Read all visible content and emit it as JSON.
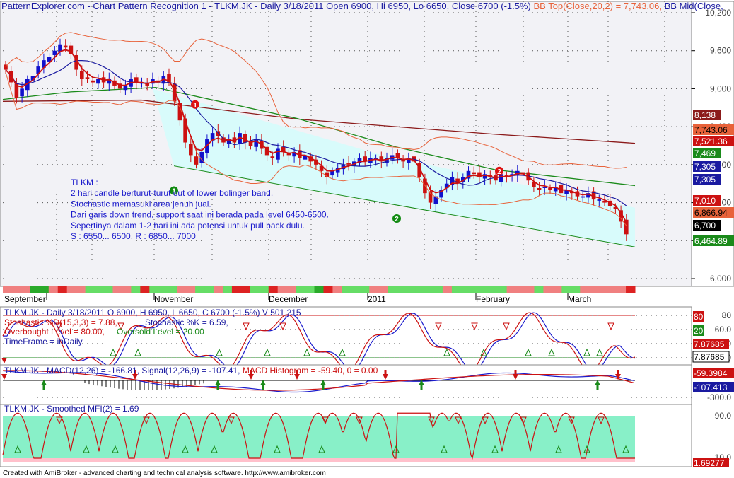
{
  "header": {
    "title_line": "PatternExplorer.com - Chart Pattern Recognition 1  - TLKM.JK - Daily 3/18/2011 Open 6900, Hi 6950, Lo 6650, Close 6700 (-1.5%)",
    "bb_top": "BB Top(Close,20,2) = 7,743.06,",
    "bb_mid": "BB Mid(Close,"
  },
  "price_axis": {
    "ticks": [
      "10,200",
      "9,600",
      "9,000",
      "8,400",
      "7,800",
      "7,200",
      "6,600",
      "6,000"
    ],
    "tick_values": [
      10200,
      9600,
      9000,
      8400,
      7800,
      7200,
      6600,
      6000
    ],
    "tags": [
      {
        "text": "8,138",
        "bg": "#8b1a1a",
        "fg": "#ffffff",
        "value": 8138
      },
      {
        "text": "7,743.06",
        "bg": "#e8623a",
        "fg": "#000000",
        "value": 7743.06
      },
      {
        "text": "7,521.36",
        "bg": "#cc1111",
        "fg": "#ffffff",
        "value": 7521.36
      },
      {
        "text": "7,469",
        "bg": "#1a8a1a",
        "fg": "#ffffff",
        "value": 7469
      },
      {
        "text": "7,305",
        "bg": "#1a1aa0",
        "fg": "#ffffff",
        "value": 7305
      },
      {
        "text": "7,305",
        "bg": "#1a1aa0",
        "fg": "#ffffff",
        "value": 7305
      },
      {
        "text": "7,010",
        "bg": "#cc1111",
        "fg": "#ffffff",
        "value": 7010
      },
      {
        "text": "6,866.94",
        "bg": "#e8623a",
        "fg": "#000000",
        "value": 6866.94
      },
      {
        "text": "6,700",
        "bg": "#000000",
        "fg": "#ffffff",
        "value": 6700
      },
      {
        "text": "6,464.89",
        "bg": "#1a8a1a",
        "fg": "#ffffff",
        "value": 6464.89
      }
    ]
  },
  "date_axis": {
    "labels": [
      {
        "text": "September",
        "x": 6
      },
      {
        "text": "November",
        "x": 218
      },
      {
        "text": "December",
        "x": 380
      },
      {
        "text": "2011",
        "x": 520
      },
      {
        "text": "February",
        "x": 673
      },
      {
        "text": "March",
        "x": 803
      }
    ]
  },
  "annotation": {
    "lines": [
      "TLKM :",
      "2 hari candle berturut-turut out of lower bolinger band.",
      "Stochastic memasuki area jenuh jual.",
      "Dari garis down trend, support saat ini berada pada level 6450-6500.",
      "Sepertinya dalam 1-2 hari ini ada potensi untuk pull back dulu.",
      "S : 6550... 6500, R : 6850... 7000"
    ]
  },
  "markers": [
    {
      "label": "1",
      "kind": "red",
      "x": 276,
      "price": 8750
    },
    {
      "label": "1",
      "kind": "green",
      "x": 246,
      "price": 7390
    },
    {
      "label": "2",
      "kind": "red",
      "x": 706,
      "price": 7700
    },
    {
      "label": "2",
      "kind": "green",
      "x": 561,
      "price": 6950
    }
  ],
  "stoch_panel": {
    "title": "TLKM.JK - Daily 3/18/2011 O 6900, H 6950, L 6650, C 6700 (-1.5%) V 501,215",
    "line2_a": "Stochastic %D(15,3,3) = 7.88,",
    "line2_b": "Stochastic %K = 6.59,",
    "line3_a": "Overbought Level = 80.00,",
    "line3_b": "Oversold Level = 20.00",
    "line4": "TimeFrame = inDaily",
    "ticks": [
      "80",
      "60.0",
      "40.0",
      "20.0"
    ],
    "tick_values": [
      80,
      60,
      40,
      20
    ],
    "tags": [
      {
        "text": "80",
        "bg": "#cc1111",
        "fg": "#ffffff",
        "value": 80
      },
      {
        "text": "20",
        "bg": "#1a8a1a",
        "fg": "#ffffff",
        "value": 20
      },
      {
        "text": "7.87685",
        "bg": "#cc1111",
        "fg": "#ffffff",
        "value": 7.88
      },
      {
        "text": "7.87685",
        "bg": "#ffffff",
        "fg": "#000000",
        "value": 7.88
      }
    ]
  },
  "macd_panel": {
    "title_a": "TLKM.JK - MACD(12,26) = -166.81,",
    "title_b": "Signal(12,26,9) = -107.41,",
    "title_c": "MACD Histogram = -59.40, 0 = 0.00",
    "ticks": [
      "-300.0"
    ],
    "tags": [
      {
        "text": "-59.3984",
        "bg": "#cc1111",
        "fg": "#ffffff"
      },
      {
        "text": "-107.413",
        "bg": "#1a1aa0",
        "fg": "#ffffff"
      }
    ]
  },
  "mfi_panel": {
    "title": "TLKM.JK - Smoothed MFI(2) = 1.69",
    "ticks": [
      "90.0",
      "10.0"
    ],
    "tags": [
      {
        "text": "1.69277",
        "bg": "#cc1111",
        "fg": "#ffffff"
      }
    ]
  },
  "footer": {
    "text": "Created with AmiBroker - advanced charting and technical analysis software. http://www.amibroker.com"
  },
  "colors": {
    "bg_plot": "#f2f2f6",
    "band_fill": "#d8fbfb",
    "bull": "#1111cc",
    "bear": "#cc1111",
    "bb": "#e8623a",
    "mid": "#1a1aa0",
    "ma_green": "#1a8a1a",
    "ma_darkred": "#8b1a1a",
    "mfi_fill": "#88f0c8"
  },
  "chart_data": {
    "type": "candlestick",
    "symbol": "TLKM.JK",
    "timeframe": "Daily",
    "last": {
      "date": "3/18/2011",
      "open": 6900,
      "high": 6950,
      "low": 6650,
      "close": 6700,
      "change_pct": -1.5,
      "volume": 501215
    },
    "ylim": [
      5900,
      10300
    ],
    "closes": [
      9300,
      9100,
      8850,
      9000,
      9150,
      9200,
      9350,
      9450,
      9500,
      9600,
      9700,
      9650,
      9550,
      9300,
      9150,
      9150,
      9100,
      9150,
      9100,
      9150,
      9050,
      9000,
      9050,
      9150,
      9100,
      9100,
      9050,
      9150,
      9100,
      9200,
      9100,
      8800,
      8500,
      8150,
      7950,
      7800,
      8000,
      8200,
      8300,
      8250,
      8150,
      8200,
      8150,
      8300,
      8150,
      8100,
      8200,
      8050,
      7950,
      7900,
      8050,
      8000,
      7950,
      8000,
      7900,
      7950,
      7850,
      7800,
      7700,
      7600,
      7700,
      7750,
      7800,
      7800,
      7850,
      7900,
      7850,
      7900,
      7900,
      7850,
      7900,
      7950,
      7900,
      7850,
      7900,
      7850,
      7600,
      7350,
      7200,
      7300,
      7400,
      7500,
      7600,
      7500,
      7600,
      7700,
      7650,
      7600,
      7650,
      7600,
      7550,
      7650,
      7600,
      7650,
      7700,
      7650,
      7550,
      7450,
      7400,
      7450,
      7400,
      7450,
      7350,
      7400,
      7350,
      7300,
      7300,
      7350,
      7250,
      7250,
      7200,
      7150,
      7100,
      6900,
      6700
    ],
    "stochastic": {
      "k_last": 6.59,
      "d_last": 7.88,
      "overbought": 80,
      "oversold": 20
    },
    "macd": {
      "macd": -166.81,
      "signal": -107.41,
      "histogram": -59.4
    },
    "mfi": {
      "smoothed_mfi_2": 1.69
    }
  }
}
